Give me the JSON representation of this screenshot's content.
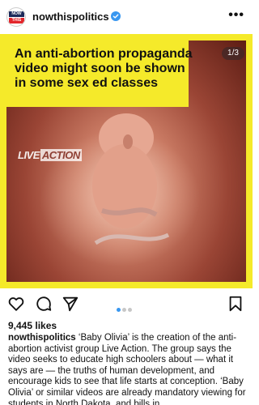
{
  "header": {
    "avatar_top": "NOW",
    "avatar_bottom": "THIS",
    "username": "nowthispolitics",
    "verified_color": "#3897f0",
    "more_label": "•••"
  },
  "post": {
    "headline": "An anti-abortion propaganda video might soon be shown in some sex ed classes",
    "counter": "1/3",
    "brand_left": "LIVE",
    "brand_right": "ACTION",
    "accent_color": "#f5ea2a",
    "carousel_position": 1,
    "carousel_total": 3
  },
  "actions": {
    "like_icon": "heart-icon",
    "comment_icon": "comment-icon",
    "share_icon": "send-icon",
    "save_icon": "bookmark-icon"
  },
  "likes": "9,445 likes",
  "caption": {
    "username": "nowthispolitics",
    "text": " ‘Baby Olivia’ is the creation of the anti-abortion activist group Live Action. The group says the video seeks to educate high schoolers about — what it says are — the truths of human development, and encourage kids to see that life starts at conception. ‘Baby Olivia’ or similar videos are already mandatory viewing for students in North Dakota, and bills in"
  }
}
